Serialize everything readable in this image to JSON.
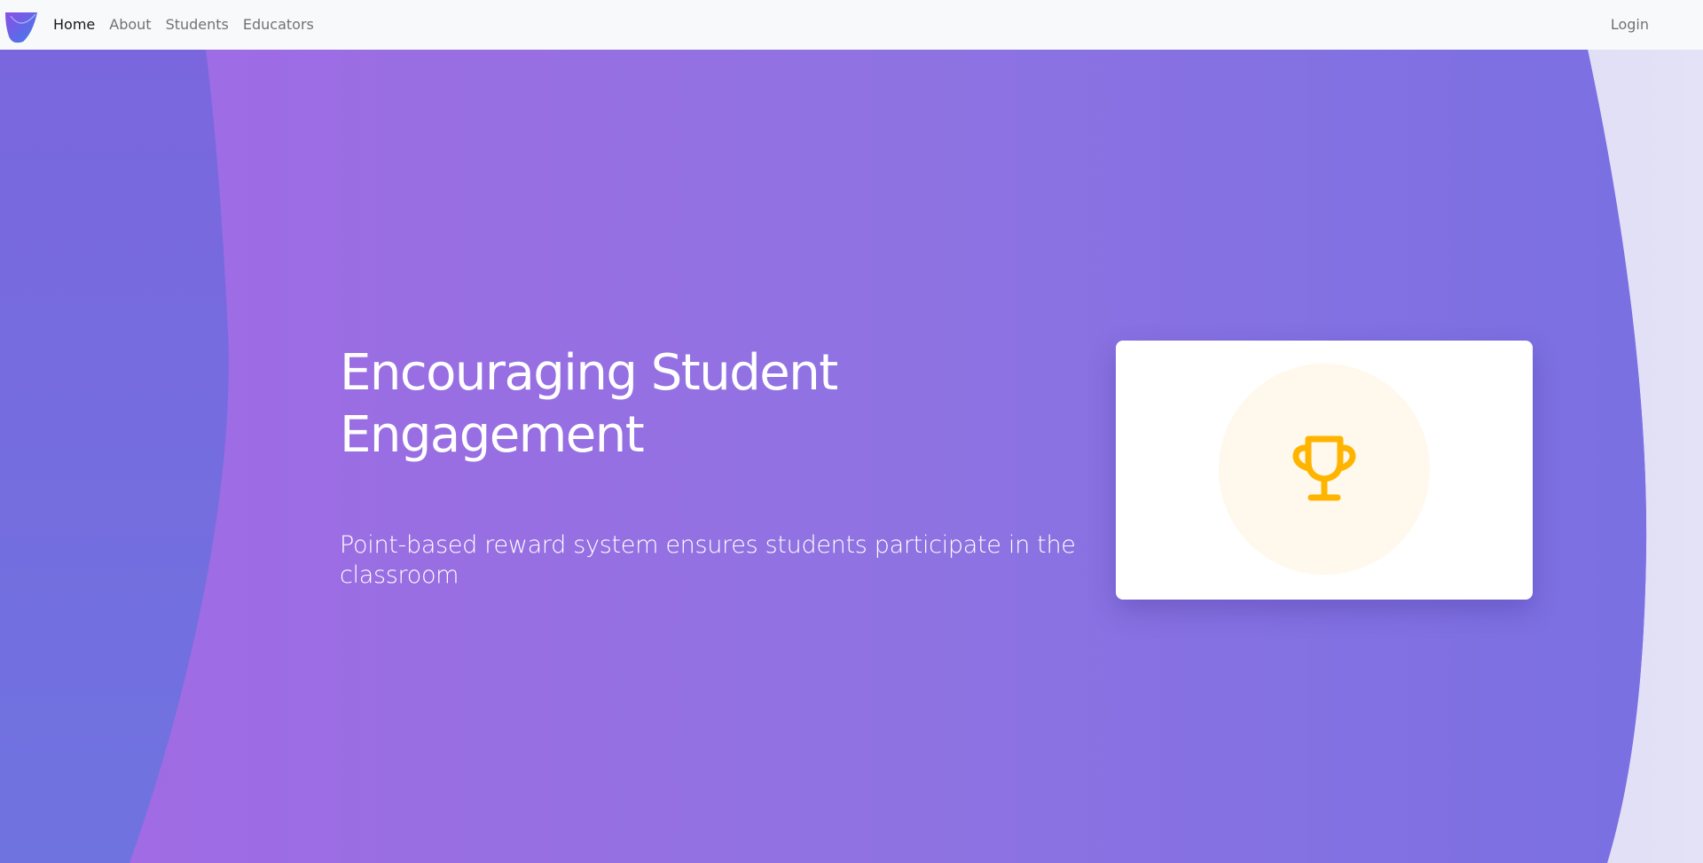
{
  "nav": {
    "brand_icon": "logo-icon",
    "items": [
      {
        "label": "Home",
        "active": true
      },
      {
        "label": "About"
      },
      {
        "label": "Students"
      },
      {
        "label": "Educators"
      }
    ],
    "login_label": "Login"
  },
  "hero": {
    "title": "Encouraging Student Engagement",
    "subtitle": "Point-based reward system ensures students participate in the classroom"
  },
  "card": {
    "icon": "trophy-icon"
  },
  "colors": {
    "navbar_bg": "#f8f9fa",
    "hero_purple": "#9a6fe3",
    "hero_blue": "#7571e0",
    "trophy": "#ffb400",
    "trophy_bg": "#fff8ec"
  }
}
